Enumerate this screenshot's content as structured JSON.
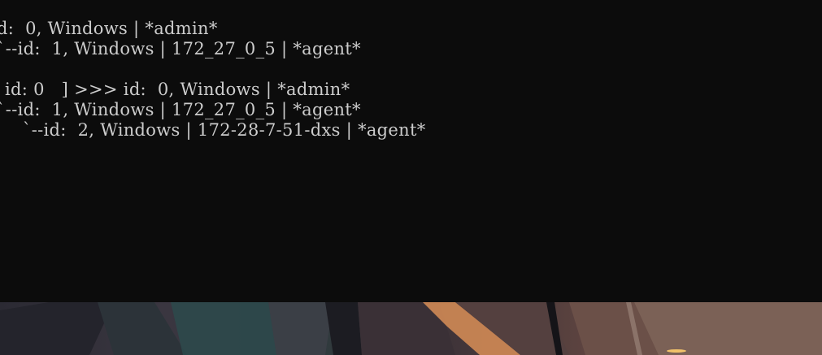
{
  "terminal": {
    "lines": [
      "d:  0, Windows | *admin*",
      "`--id:  1, Windows | 172_27_0_5 | *agent*",
      " id: 0   ] >>> id:  0, Windows | *admin*",
      "`--id:  1, Windows | 172_27_0_5 | *agent*",
      "    `--id:  2, Windows | 172-28-7-51-dxs | *agent*"
    ]
  },
  "colors": {
    "terminal_background": "#0c0c0c",
    "terminal_text": "#cccccc"
  }
}
